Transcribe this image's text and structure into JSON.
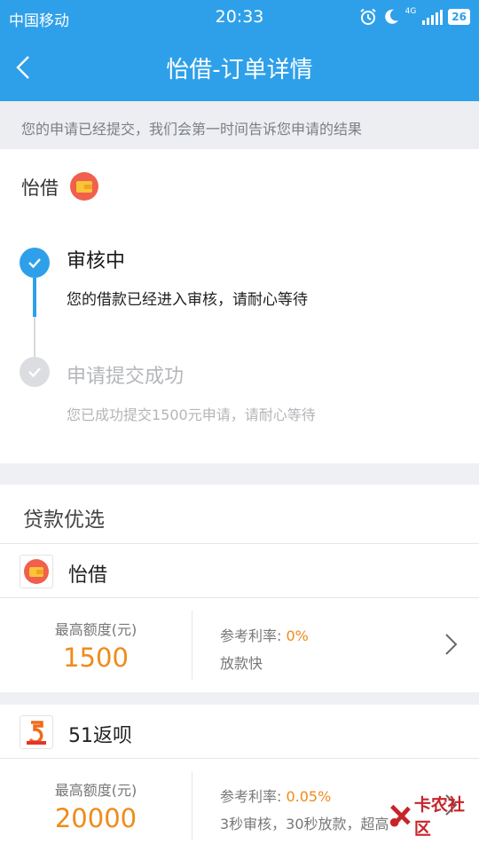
{
  "status_bar": {
    "carrier": "中国移动",
    "time": "20:33",
    "network": "4G",
    "battery": "26",
    "icons": [
      "alarm-icon",
      "moon-icon",
      "signal-icon"
    ]
  },
  "header": {
    "title": "怡借-订单详情",
    "back_icon": "chevron-left-icon"
  },
  "notice": "您的申请已经提交，我们会第一时间告诉您申请的结果",
  "brand": {
    "name": "怡借",
    "logo_icon": "wallet-icon"
  },
  "timeline": [
    {
      "title": "审核中",
      "desc": "您的借款已经进入审核，请耐心等待",
      "state": "active"
    },
    {
      "title": "申请提交成功",
      "desc": "您已成功提交1500元申请，请耐心等待",
      "state": "done"
    }
  ],
  "recommend": {
    "title": "贷款优选",
    "products": [
      {
        "name": "怡借",
        "amount_label": "最高额度(元)",
        "amount": "1500",
        "rate_label": "参考利率: ",
        "rate": "0%",
        "tag": "放款快",
        "logo_icon": "wallet-icon"
      },
      {
        "name": "51返呗",
        "amount_label": "最高额度(元)",
        "amount": "20000",
        "rate_label": "参考利率: ",
        "rate": "0.05%",
        "tag": "3秒审核，30秒放款，超高",
        "logo_icon": "fanbei-logo-icon"
      }
    ]
  },
  "watermark": "卡农社区",
  "colors": {
    "primary": "#2ea0ea",
    "accent": "#ef8b1b",
    "muted": "#b5b7bb"
  }
}
